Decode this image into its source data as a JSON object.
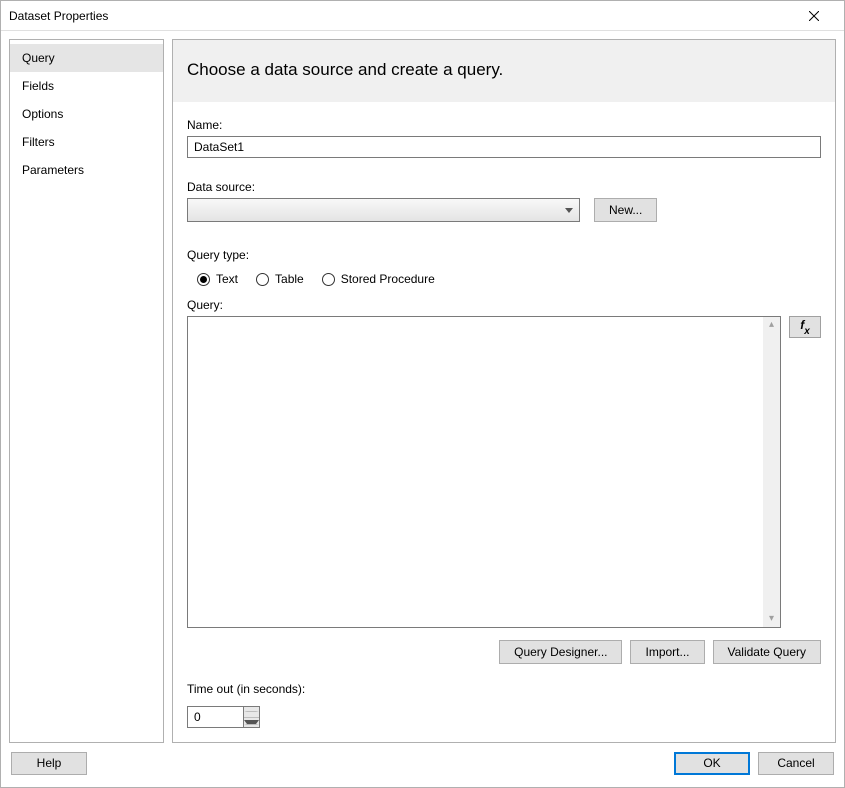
{
  "window": {
    "title": "Dataset Properties"
  },
  "sidebar": {
    "items": [
      {
        "label": "Query",
        "selected": true
      },
      {
        "label": "Fields",
        "selected": false
      },
      {
        "label": "Options",
        "selected": false
      },
      {
        "label": "Filters",
        "selected": false
      },
      {
        "label": "Parameters",
        "selected": false
      }
    ]
  },
  "header": {
    "title": "Choose a data source and create a query."
  },
  "form": {
    "name_label": "Name:",
    "name_value": "DataSet1",
    "datasource_label": "Data source:",
    "datasource_value": "",
    "new_button": "New...",
    "querytype_label": "Query type:",
    "querytype_options": [
      {
        "label": "Text",
        "checked": true
      },
      {
        "label": "Table",
        "checked": false
      },
      {
        "label": "Stored Procedure",
        "checked": false
      }
    ],
    "query_label": "Query:",
    "query_value": "",
    "fx_label": "fx",
    "query_designer_button": "Query Designer...",
    "import_button": "Import...",
    "validate_button": "Validate Query",
    "timeout_label": "Time out (in seconds):",
    "timeout_value": "0"
  },
  "footer": {
    "help": "Help",
    "ok": "OK",
    "cancel": "Cancel"
  }
}
